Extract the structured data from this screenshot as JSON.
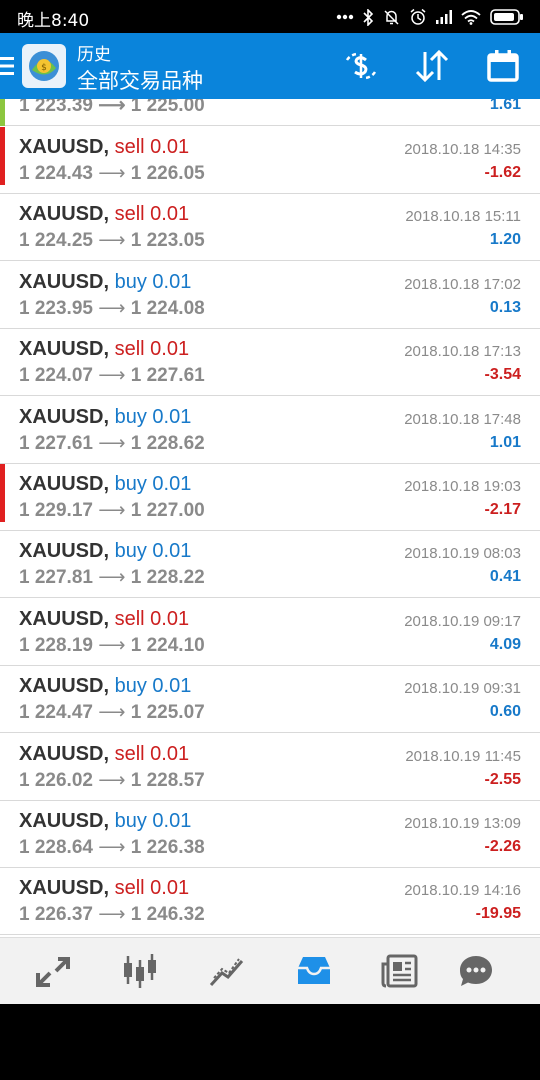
{
  "status_bar": {
    "time": "晚上8:40"
  },
  "app_bar": {
    "title_top": "历史",
    "title_bottom": "全部交易品种"
  },
  "colors": {
    "app_bar": "#0a84db",
    "sell": "#cc1f1f",
    "buy": "#1779c9",
    "profit_positive": "#1779c9",
    "profit_negative": "#cc1f1f",
    "accent_green": "#8cc63f",
    "accent_red": "#e02020",
    "nav_active": "#1e90e8",
    "nav_inactive": "#666666"
  },
  "partial_row": {
    "prices": "1 223.39 ⟶ 1 225.00",
    "profit": "1.61",
    "accent": "green"
  },
  "trades": [
    {
      "symbol": "XAUUSD",
      "side": "sell",
      "volume": "0.01",
      "open": "1 224.43",
      "close": "1 226.05",
      "datetime": "2018.10.18 14:35",
      "profit": "-1.62",
      "accent": "red"
    },
    {
      "symbol": "XAUUSD",
      "side": "sell",
      "volume": "0.01",
      "open": "1 224.25",
      "close": "1 223.05",
      "datetime": "2018.10.18 15:11",
      "profit": "1.20",
      "accent": ""
    },
    {
      "symbol": "XAUUSD",
      "side": "buy",
      "volume": "0.01",
      "open": "1 223.95",
      "close": "1 224.08",
      "datetime": "2018.10.18 17:02",
      "profit": "0.13",
      "accent": ""
    },
    {
      "symbol": "XAUUSD",
      "side": "sell",
      "volume": "0.01",
      "open": "1 224.07",
      "close": "1 227.61",
      "datetime": "2018.10.18 17:13",
      "profit": "-3.54",
      "accent": ""
    },
    {
      "symbol": "XAUUSD",
      "side": "buy",
      "volume": "0.01",
      "open": "1 227.61",
      "close": "1 228.62",
      "datetime": "2018.10.18 17:48",
      "profit": "1.01",
      "accent": ""
    },
    {
      "symbol": "XAUUSD",
      "side": "buy",
      "volume": "0.01",
      "open": "1 229.17",
      "close": "1 227.00",
      "datetime": "2018.10.18 19:03",
      "profit": "-2.17",
      "accent": "red"
    },
    {
      "symbol": "XAUUSD",
      "side": "buy",
      "volume": "0.01",
      "open": "1 227.81",
      "close": "1 228.22",
      "datetime": "2018.10.19 08:03",
      "profit": "0.41",
      "accent": ""
    },
    {
      "symbol": "XAUUSD",
      "side": "sell",
      "volume": "0.01",
      "open": "1 228.19",
      "close": "1 224.10",
      "datetime": "2018.10.19 09:17",
      "profit": "4.09",
      "accent": ""
    },
    {
      "symbol": "XAUUSD",
      "side": "buy",
      "volume": "0.01",
      "open": "1 224.47",
      "close": "1 225.07",
      "datetime": "2018.10.19 09:31",
      "profit": "0.60",
      "accent": ""
    },
    {
      "symbol": "XAUUSD",
      "side": "sell",
      "volume": "0.01",
      "open": "1 226.02",
      "close": "1 228.57",
      "datetime": "2018.10.19 11:45",
      "profit": "-2.55",
      "accent": ""
    },
    {
      "symbol": "XAUUSD",
      "side": "buy",
      "volume": "0.01",
      "open": "1 228.64",
      "close": "1 226.38",
      "datetime": "2018.10.19 13:09",
      "profit": "-2.26",
      "accent": ""
    },
    {
      "symbol": "XAUUSD",
      "side": "sell",
      "volume": "0.01",
      "open": "1 226.37",
      "close": "1 246.32",
      "datetime": "2018.10.19 14:16",
      "profit": "-19.95",
      "accent": ""
    }
  ],
  "bottom_nav": [
    "quotes-icon",
    "chart-icon",
    "trade-icon",
    "history-icon",
    "news-icon",
    "chat-icon"
  ]
}
